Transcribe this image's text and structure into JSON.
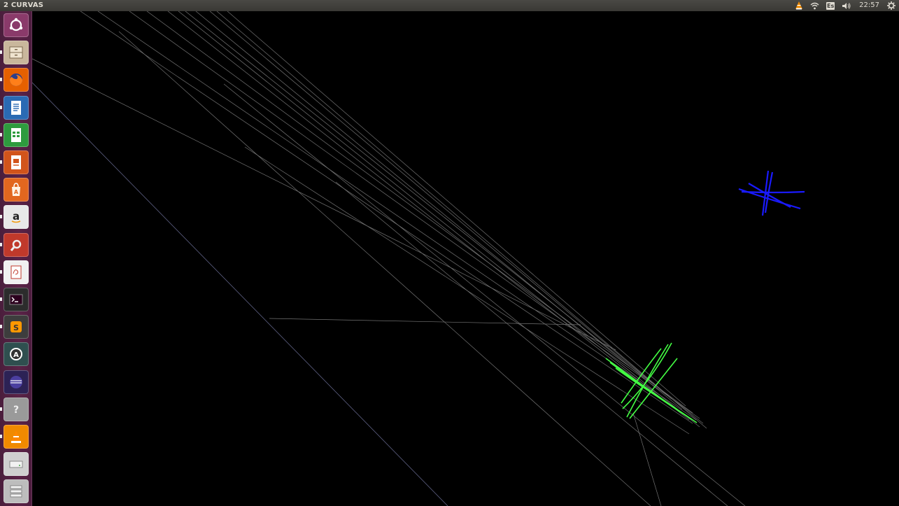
{
  "top_panel": {
    "window_title": "2 CURVAS",
    "keyboard_layout": "Es",
    "clock": "22:57",
    "indicators": [
      "vlc-tray-icon",
      "wifi-icon",
      "keyboard-layout-indicator",
      "volume-icon",
      "clock",
      "system-gear-icon"
    ]
  },
  "launcher": {
    "items": [
      {
        "name": "dash-home-button",
        "icon": "ubuntu-logo-icon",
        "bg": "#8a3a6a"
      },
      {
        "name": "files-launcher",
        "icon": "files-cabinet-icon",
        "bg": "#c9b79c"
      },
      {
        "name": "firefox-launcher",
        "icon": "firefox-icon",
        "bg": "#e66000"
      },
      {
        "name": "writer-launcher",
        "icon": "libreoffice-writer-icon",
        "bg": "#2a6ab3"
      },
      {
        "name": "calc-launcher",
        "icon": "libreoffice-calc-icon",
        "bg": "#2e9b3e"
      },
      {
        "name": "impress-launcher",
        "icon": "libreoffice-impress-icon",
        "bg": "#d2541b"
      },
      {
        "name": "software-center-launcher",
        "icon": "ubuntu-software-icon",
        "bg": "#e2671f"
      },
      {
        "name": "amazon-launcher",
        "icon": "amazon-icon",
        "bg": "#e8e8e8"
      },
      {
        "name": "system-settings-launcher",
        "icon": "settings-wrench-icon",
        "bg": "#c0392b"
      },
      {
        "name": "draw-launcher",
        "icon": "drawing-app-icon",
        "bg": "#f0f0f0"
      },
      {
        "name": "terminal-launcher",
        "icon": "terminal-icon",
        "bg": "#2c2c2c"
      },
      {
        "name": "sublime-launcher",
        "icon": "sublime-text-icon",
        "bg": "#3d3d3d"
      },
      {
        "name": "software-updater-launcher",
        "icon": "software-updater-icon",
        "bg": "#2f4f4f"
      },
      {
        "name": "eclipse-launcher",
        "icon": "eclipse-icon",
        "bg": "#2c2255"
      },
      {
        "name": "help-launcher",
        "icon": "help-question-icon",
        "bg": "#9a9a9a"
      },
      {
        "name": "vlc-launcher",
        "icon": "vlc-cone-icon",
        "bg": "#f08a00"
      },
      {
        "name": "drive-launcher",
        "icon": "removable-drive-icon",
        "bg": "#cfcfcf"
      },
      {
        "name": "workspaces-launcher",
        "icon": "workspace-switcher-icon",
        "bg": "#bdbdbd"
      }
    ]
  },
  "scene": {
    "background_color": "#000000",
    "line_color": "#9a9a9a",
    "green_curve_color": "#44ff44",
    "blue_curve_color": "#1a1aff"
  }
}
